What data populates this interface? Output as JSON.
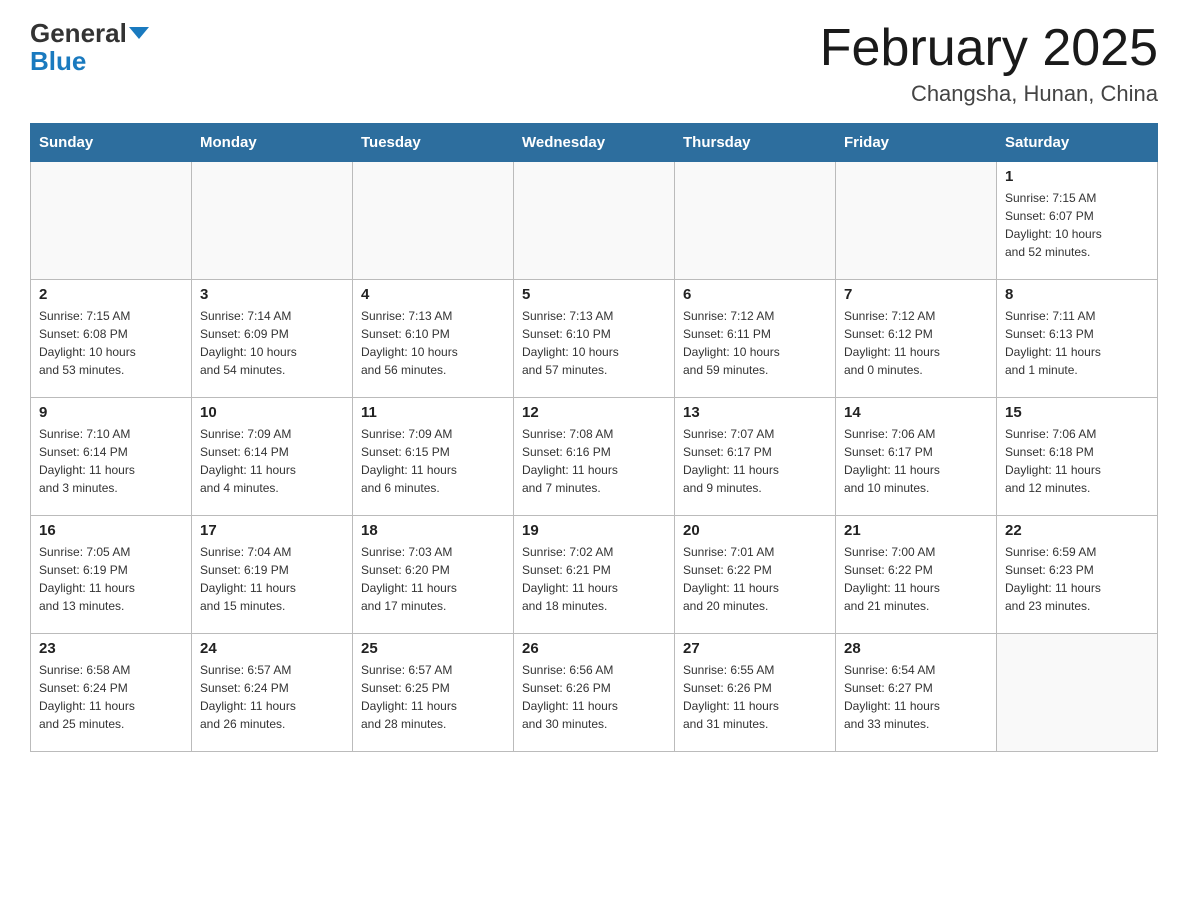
{
  "header": {
    "logo_line1": "General",
    "logo_line2": "Blue",
    "title": "February 2025",
    "subtitle": "Changsha, Hunan, China"
  },
  "weekdays": [
    "Sunday",
    "Monday",
    "Tuesday",
    "Wednesday",
    "Thursday",
    "Friday",
    "Saturday"
  ],
  "weeks": [
    [
      {
        "day": "",
        "info": ""
      },
      {
        "day": "",
        "info": ""
      },
      {
        "day": "",
        "info": ""
      },
      {
        "day": "",
        "info": ""
      },
      {
        "day": "",
        "info": ""
      },
      {
        "day": "",
        "info": ""
      },
      {
        "day": "1",
        "info": "Sunrise: 7:15 AM\nSunset: 6:07 PM\nDaylight: 10 hours\nand 52 minutes."
      }
    ],
    [
      {
        "day": "2",
        "info": "Sunrise: 7:15 AM\nSunset: 6:08 PM\nDaylight: 10 hours\nand 53 minutes."
      },
      {
        "day": "3",
        "info": "Sunrise: 7:14 AM\nSunset: 6:09 PM\nDaylight: 10 hours\nand 54 minutes."
      },
      {
        "day": "4",
        "info": "Sunrise: 7:13 AM\nSunset: 6:10 PM\nDaylight: 10 hours\nand 56 minutes."
      },
      {
        "day": "5",
        "info": "Sunrise: 7:13 AM\nSunset: 6:10 PM\nDaylight: 10 hours\nand 57 minutes."
      },
      {
        "day": "6",
        "info": "Sunrise: 7:12 AM\nSunset: 6:11 PM\nDaylight: 10 hours\nand 59 minutes."
      },
      {
        "day": "7",
        "info": "Sunrise: 7:12 AM\nSunset: 6:12 PM\nDaylight: 11 hours\nand 0 minutes."
      },
      {
        "day": "8",
        "info": "Sunrise: 7:11 AM\nSunset: 6:13 PM\nDaylight: 11 hours\nand 1 minute."
      }
    ],
    [
      {
        "day": "9",
        "info": "Sunrise: 7:10 AM\nSunset: 6:14 PM\nDaylight: 11 hours\nand 3 minutes."
      },
      {
        "day": "10",
        "info": "Sunrise: 7:09 AM\nSunset: 6:14 PM\nDaylight: 11 hours\nand 4 minutes."
      },
      {
        "day": "11",
        "info": "Sunrise: 7:09 AM\nSunset: 6:15 PM\nDaylight: 11 hours\nand 6 minutes."
      },
      {
        "day": "12",
        "info": "Sunrise: 7:08 AM\nSunset: 6:16 PM\nDaylight: 11 hours\nand 7 minutes."
      },
      {
        "day": "13",
        "info": "Sunrise: 7:07 AM\nSunset: 6:17 PM\nDaylight: 11 hours\nand 9 minutes."
      },
      {
        "day": "14",
        "info": "Sunrise: 7:06 AM\nSunset: 6:17 PM\nDaylight: 11 hours\nand 10 minutes."
      },
      {
        "day": "15",
        "info": "Sunrise: 7:06 AM\nSunset: 6:18 PM\nDaylight: 11 hours\nand 12 minutes."
      }
    ],
    [
      {
        "day": "16",
        "info": "Sunrise: 7:05 AM\nSunset: 6:19 PM\nDaylight: 11 hours\nand 13 minutes."
      },
      {
        "day": "17",
        "info": "Sunrise: 7:04 AM\nSunset: 6:19 PM\nDaylight: 11 hours\nand 15 minutes."
      },
      {
        "day": "18",
        "info": "Sunrise: 7:03 AM\nSunset: 6:20 PM\nDaylight: 11 hours\nand 17 minutes."
      },
      {
        "day": "19",
        "info": "Sunrise: 7:02 AM\nSunset: 6:21 PM\nDaylight: 11 hours\nand 18 minutes."
      },
      {
        "day": "20",
        "info": "Sunrise: 7:01 AM\nSunset: 6:22 PM\nDaylight: 11 hours\nand 20 minutes."
      },
      {
        "day": "21",
        "info": "Sunrise: 7:00 AM\nSunset: 6:22 PM\nDaylight: 11 hours\nand 21 minutes."
      },
      {
        "day": "22",
        "info": "Sunrise: 6:59 AM\nSunset: 6:23 PM\nDaylight: 11 hours\nand 23 minutes."
      }
    ],
    [
      {
        "day": "23",
        "info": "Sunrise: 6:58 AM\nSunset: 6:24 PM\nDaylight: 11 hours\nand 25 minutes."
      },
      {
        "day": "24",
        "info": "Sunrise: 6:57 AM\nSunset: 6:24 PM\nDaylight: 11 hours\nand 26 minutes."
      },
      {
        "day": "25",
        "info": "Sunrise: 6:57 AM\nSunset: 6:25 PM\nDaylight: 11 hours\nand 28 minutes."
      },
      {
        "day": "26",
        "info": "Sunrise: 6:56 AM\nSunset: 6:26 PM\nDaylight: 11 hours\nand 30 minutes."
      },
      {
        "day": "27",
        "info": "Sunrise: 6:55 AM\nSunset: 6:26 PM\nDaylight: 11 hours\nand 31 minutes."
      },
      {
        "day": "28",
        "info": "Sunrise: 6:54 AM\nSunset: 6:27 PM\nDaylight: 11 hours\nand 33 minutes."
      },
      {
        "day": "",
        "info": ""
      }
    ]
  ]
}
